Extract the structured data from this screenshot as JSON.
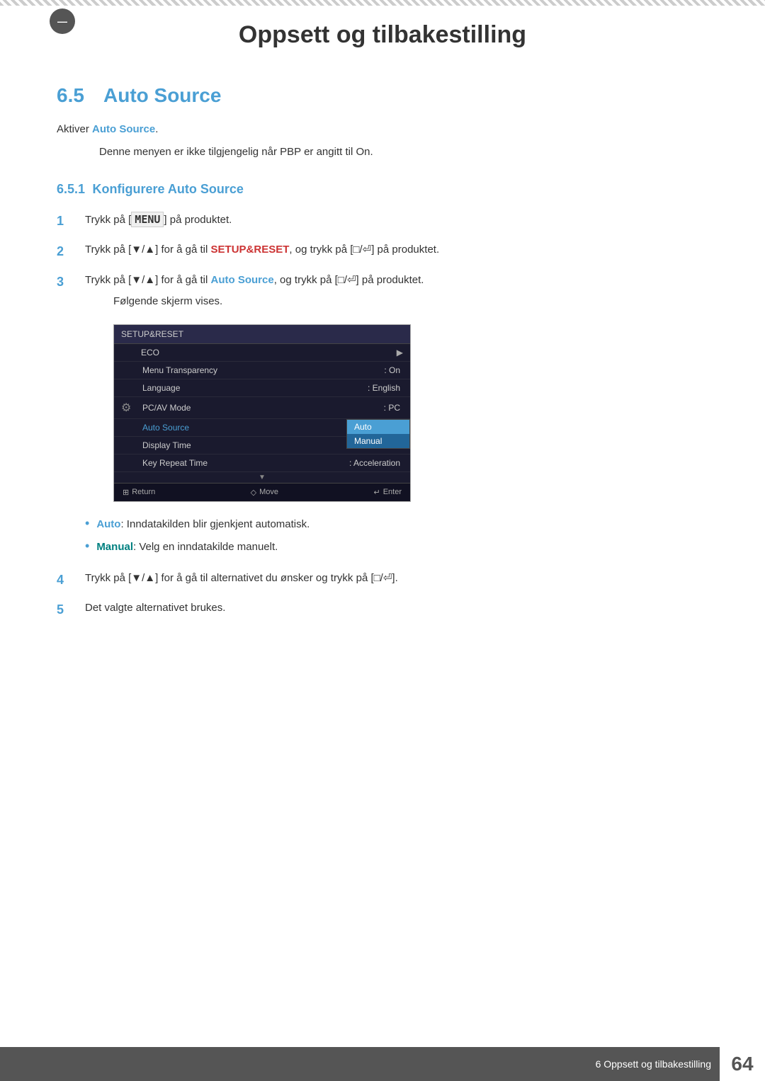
{
  "page": {
    "top_stripe": true,
    "chapter_circle": "—",
    "main_title": "Oppsett og tilbakestilling",
    "section_number": "6.5",
    "section_title": "Auto Source",
    "description_line": "Aktiver",
    "description_highlight": "Auto Source",
    "description_suffix": ".",
    "note_text": "Denne menyen er ikke tilgjengelig når",
    "note_highlight_red": "PBP",
    "note_suffix": "er angitt til",
    "note_highlight_green": "On",
    "note_end": ".",
    "subsection": {
      "number": "6.5.1",
      "title": "Konfigurere Auto Source"
    },
    "steps": [
      {
        "number": "1",
        "text": "Trykk på [",
        "key": "MENU",
        "text2": "] på produktet."
      },
      {
        "number": "2",
        "text_pre": "Trykk på [▼/▲] for å gå til ",
        "highlight_red": "SETUP&RESET",
        "text_post": ", og trykk på [□/⏎] på produktet."
      },
      {
        "number": "3",
        "text_pre": "Trykk på [▼/▲] for å gå til ",
        "highlight_blue": "Auto Source",
        "text_post": ", og trykk på [□/⏎] på produktet.",
        "sub": "Følgende skjerm vises."
      }
    ],
    "screen": {
      "header": "SETUP&RESET",
      "rows": [
        {
          "label": "ECO",
          "value": "",
          "arrow": "▶",
          "icon": ""
        },
        {
          "label": "Menu Transparency",
          "value": ": On",
          "icon": ""
        },
        {
          "label": "Language",
          "value": ": English",
          "icon": ""
        },
        {
          "label": "PC/AV Mode",
          "value": ": PC",
          "icon": "⚙"
        },
        {
          "label": "Auto Source",
          "value": "",
          "submenu": [
            "Auto",
            "Manual"
          ],
          "selected": 1,
          "icon": ""
        },
        {
          "label": "Display Time",
          "value": "",
          "icon": ""
        },
        {
          "label": "Key Repeat Time",
          "value": ": Acceleration",
          "icon": ""
        }
      ],
      "footer": [
        {
          "icon": "⊞",
          "label": "Return"
        },
        {
          "icon": "◇",
          "label": "Move"
        },
        {
          "icon": "↵",
          "label": "Enter"
        }
      ]
    },
    "bullets": [
      {
        "label": "Auto",
        "label_color": "blue",
        "text": ": Inndatakilden blir gjenkjent automatisk."
      },
      {
        "label": "Manual",
        "label_color": "cyan",
        "text": ": Velg en inndatakilde manuelt."
      }
    ],
    "steps_cont": [
      {
        "number": "4",
        "text": "Trykk på [▼/▲] for å gå til alternativet du ønsker og trykk på [□/⏎]."
      },
      {
        "number": "5",
        "text": "Det valgte alternativet brukes."
      }
    ],
    "footer": {
      "chapter_label": "6 Oppsett og tilbakestilling",
      "page_number": "64"
    }
  }
}
